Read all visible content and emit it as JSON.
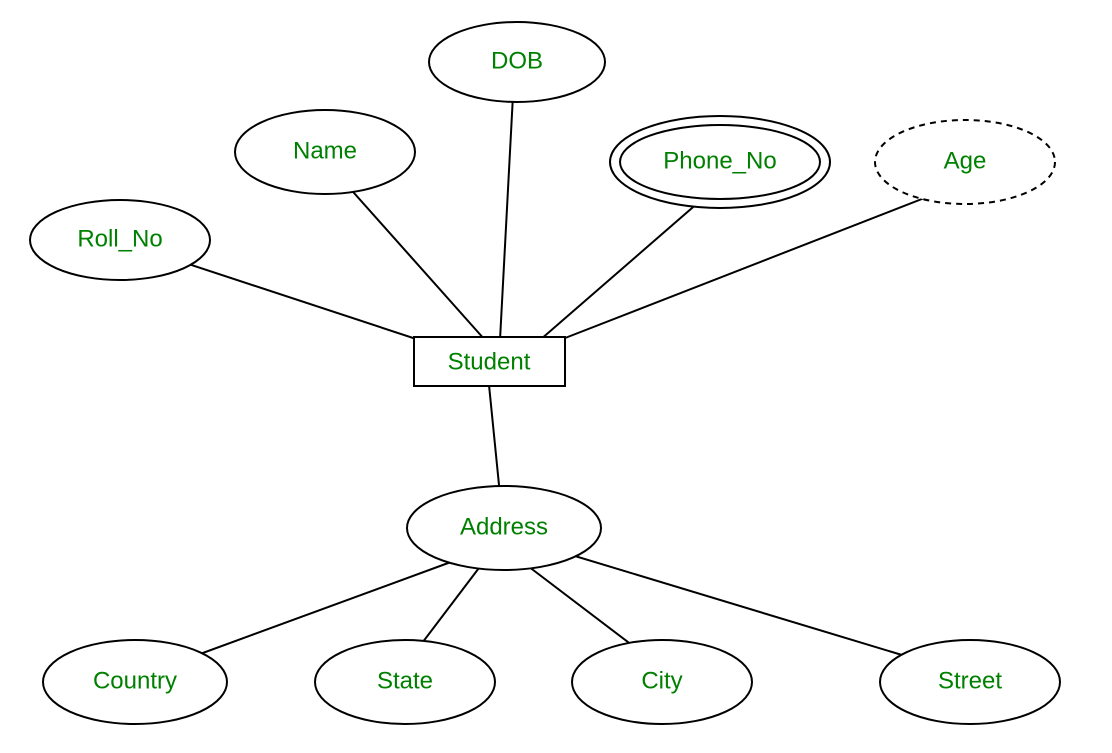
{
  "diagram": {
    "entity": {
      "label": "Student"
    },
    "attributes": {
      "roll_no": {
        "label": "Roll_No"
      },
      "name": {
        "label": "Name"
      },
      "dob": {
        "label": "DOB"
      },
      "phone_no": {
        "label": "Phone_No"
      },
      "age": {
        "label": "Age"
      },
      "address": {
        "label": "Address"
      },
      "country": {
        "label": "Country"
      },
      "state": {
        "label": "State"
      },
      "city": {
        "label": "City"
      },
      "street": {
        "label": "Street"
      }
    }
  }
}
